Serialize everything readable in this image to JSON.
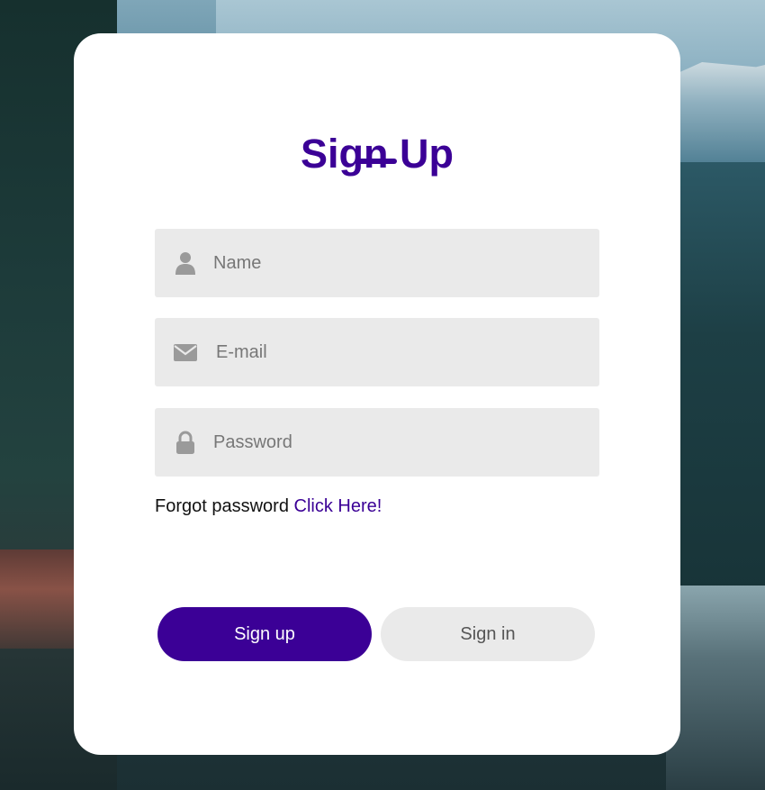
{
  "form": {
    "title": "Sign Up",
    "fields": [
      {
        "icon": "user-icon",
        "placeholder": "Name",
        "value": ""
      },
      {
        "icon": "envelope-icon",
        "placeholder": "E-mail",
        "value": ""
      },
      {
        "icon": "lock-icon",
        "placeholder": "Password",
        "value": ""
      }
    ],
    "forgot_text": "Forgot password",
    "forgot_link": "Click Here!",
    "signup_label": "Sign up",
    "signin_label": "Sign in"
  },
  "colors": {
    "accent": "#3b0096",
    "field_bg": "#eaeaea",
    "icon": "#9a9a9a",
    "card_bg": "#ffffff"
  }
}
